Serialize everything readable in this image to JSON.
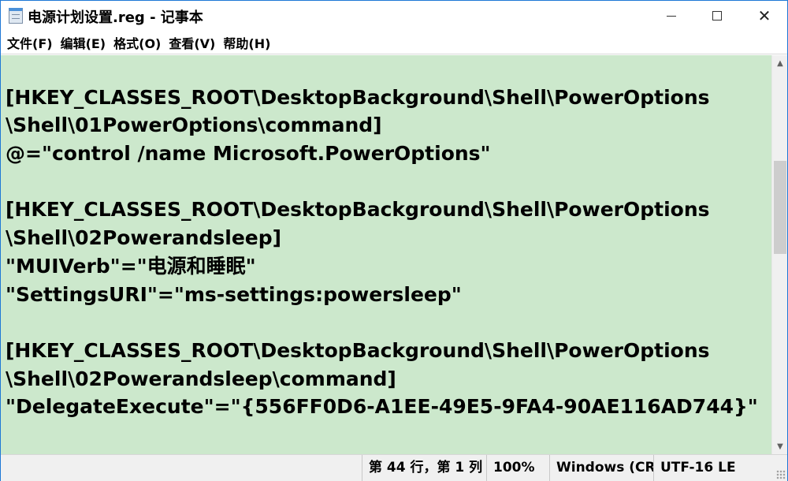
{
  "window": {
    "title": "电源计划设置.reg - 记事本"
  },
  "menu": {
    "items": [
      "文件(F)",
      "编辑(E)",
      "格式(O)",
      "查看(V)",
      "帮助(H)"
    ]
  },
  "editor": {
    "background": "#cce8cc",
    "lines": [
      "",
      "[HKEY_CLASSES_ROOT\\DesktopBackground\\Shell\\PowerOptions",
      "\\Shell\\01PowerOptions\\command]",
      "@=\"control /name Microsoft.PowerOptions\"",
      "",
      "[HKEY_CLASSES_ROOT\\DesktopBackground\\Shell\\PowerOptions",
      "\\Shell\\02Powerandsleep]",
      "\"MUIVerb\"=\"电源和睡眠\"",
      "\"SettingsURI\"=\"ms-settings:powersleep\"",
      "",
      "[HKEY_CLASSES_ROOT\\DesktopBackground\\Shell\\PowerOptions",
      "\\Shell\\02Powerandsleep\\command]",
      "\"DelegateExecute\"=\"{556FF0D6-A1EE-49E5-9FA4-90AE116AD744}\""
    ]
  },
  "statusbar": {
    "position": "第 44 行，第 1 列",
    "zoom": "100%",
    "line_ending": "Windows (CRLF)",
    "encoding": "UTF-16 LE"
  },
  "icons": {
    "app": "notepad-icon",
    "minimize": "minimize-icon",
    "maximize": "maximize-icon",
    "close": "close-icon"
  }
}
